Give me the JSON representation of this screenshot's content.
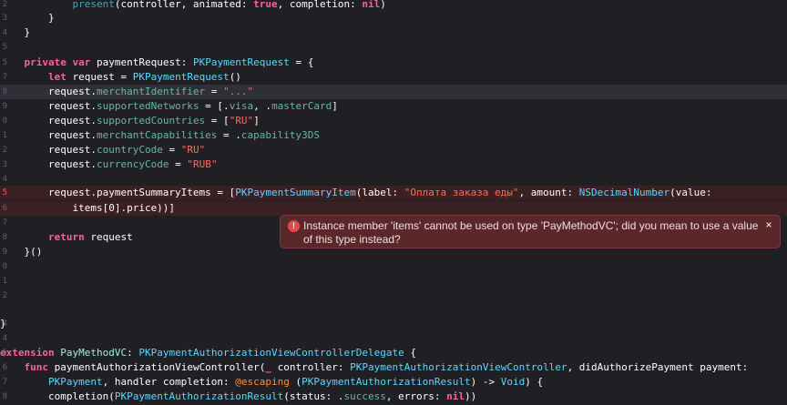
{
  "editor": {
    "lines": [
      {
        "num": "2",
        "segments": [
          [
            "pl",
            "            "
          ],
          [
            "fn",
            "present"
          ],
          [
            "pl",
            "(controller, animated: "
          ],
          [
            "kw",
            "true"
          ],
          [
            "pl",
            ", completion: "
          ],
          [
            "kw",
            "nil"
          ],
          [
            "pl",
            ")"
          ]
        ]
      },
      {
        "num": "3",
        "segments": [
          [
            "pl",
            "        }"
          ]
        ]
      },
      {
        "num": "4",
        "segments": [
          [
            "pl",
            "    }"
          ]
        ]
      },
      {
        "num": "5",
        "segments": []
      },
      {
        "num": "5",
        "segments": [
          [
            "pl",
            "    "
          ],
          [
            "kw",
            "private"
          ],
          [
            "pl",
            " "
          ],
          [
            "kw",
            "var"
          ],
          [
            "pl",
            " paymentRequest: "
          ],
          [
            "ty",
            "PKPaymentRequest"
          ],
          [
            "pl",
            " = {"
          ]
        ]
      },
      {
        "num": "7",
        "segments": [
          [
            "pl",
            "        "
          ],
          [
            "kw",
            "let"
          ],
          [
            "pl",
            " request = "
          ],
          [
            "ty",
            "PKPaymentRequest"
          ],
          [
            "pl",
            "()"
          ]
        ]
      },
      {
        "num": "8",
        "segments": [
          [
            "pl",
            "        request."
          ],
          [
            "prop",
            "merchantIdentifier"
          ],
          [
            "pl",
            " = "
          ],
          [
            "str",
            "\"...\""
          ]
        ]
      },
      {
        "num": "9",
        "segments": [
          [
            "pl",
            "        request."
          ],
          [
            "prop",
            "supportedNetworks"
          ],
          [
            "pl",
            " = [."
          ],
          [
            "prop",
            "visa"
          ],
          [
            "pl",
            ", ."
          ],
          [
            "prop",
            "masterCard"
          ],
          [
            "pl",
            "]"
          ]
        ]
      },
      {
        "num": "0",
        "segments": [
          [
            "pl",
            "        request."
          ],
          [
            "prop",
            "supportedCountries"
          ],
          [
            "pl",
            " = ["
          ],
          [
            "str",
            "\"RU\""
          ],
          [
            "pl",
            "]"
          ]
        ]
      },
      {
        "num": "1",
        "segments": [
          [
            "pl",
            "        request."
          ],
          [
            "prop",
            "merchantCapabilities"
          ],
          [
            "pl",
            " = ."
          ],
          [
            "prop",
            "capability3DS"
          ]
        ]
      },
      {
        "num": "2",
        "segments": [
          [
            "pl",
            "        request."
          ],
          [
            "prop",
            "countryCode"
          ],
          [
            "pl",
            " = "
          ],
          [
            "str",
            "\"RU\""
          ]
        ]
      },
      {
        "num": "3",
        "segments": [
          [
            "pl",
            "        request."
          ],
          [
            "prop",
            "currencyCode"
          ],
          [
            "pl",
            " = "
          ],
          [
            "str",
            "\"RUB\""
          ]
        ]
      },
      {
        "num": "4",
        "segments": []
      },
      {
        "num": "5",
        "segments": [
          [
            "pl",
            "        request.paymentSummaryItems = ["
          ],
          [
            "ty",
            "PKPaymentSummaryItem"
          ],
          [
            "pl",
            "(label: "
          ],
          [
            "str",
            "\"Оплата заказа еды\""
          ],
          [
            "pl",
            ", amount: "
          ],
          [
            "ty",
            "NSDecimalNumber"
          ],
          [
            "pl",
            "(value:"
          ]
        ]
      },
      {
        "num": "6",
        "segments": [
          [
            "pl",
            "            items[0].price))]"
          ]
        ]
      },
      {
        "num": "7",
        "segments": []
      },
      {
        "num": "8",
        "segments": [
          [
            "pl",
            "        "
          ],
          [
            "kw",
            "return"
          ],
          [
            "pl",
            " request"
          ]
        ]
      },
      {
        "num": "9",
        "segments": [
          [
            "pl",
            "    }()"
          ]
        ]
      },
      {
        "num": "0",
        "segments": []
      },
      {
        "num": "1",
        "segments": []
      },
      {
        "num": "2",
        "segments": []
      },
      {
        "num": "3",
        "segments": [
          [
            "pl",
            "}"
          ]
        ]
      },
      {
        "num": "4",
        "segments": []
      },
      {
        "num": "5",
        "segments": [
          [
            "kw",
            "extension"
          ],
          [
            "pl",
            " "
          ],
          [
            "cls",
            "PayMethodVC"
          ],
          [
            "pl",
            ": "
          ],
          [
            "ty",
            "PKPaymentAuthorizationViewControllerDelegate"
          ],
          [
            "pl",
            " {"
          ]
        ]
      },
      {
        "num": "6",
        "segments": [
          [
            "pl",
            "    "
          ],
          [
            "kw",
            "func"
          ],
          [
            "pl",
            " paymentAuthorizationViewController("
          ],
          [
            "kw",
            "_"
          ],
          [
            "pl",
            " controller: "
          ],
          [
            "ty",
            "PKPaymentAuthorizationViewController"
          ],
          [
            "pl",
            ", didAuthorizePayment payment:"
          ]
        ]
      },
      {
        "num": "7",
        "segments": [
          [
            "pl",
            "        "
          ],
          [
            "ty",
            "PKPayment"
          ],
          [
            "pl",
            ", handler completion: "
          ],
          [
            "at",
            "@escaping"
          ],
          [
            "pl",
            " ("
          ],
          [
            "ty",
            "PKPaymentAuthorizationResult"
          ],
          [
            "pl",
            ") -> "
          ],
          [
            "ty",
            "Void"
          ],
          [
            "pl",
            ") {"
          ]
        ]
      },
      {
        "num": "8",
        "segments": [
          [
            "pl",
            "        completion("
          ],
          [
            "ty",
            "PKPaymentAuthorizationResult"
          ],
          [
            "pl",
            "(status: ."
          ],
          [
            "prop",
            "success"
          ],
          [
            "pl",
            ", errors: "
          ],
          [
            "kw",
            "nil"
          ],
          [
            "pl",
            "))"
          ]
        ]
      }
    ]
  },
  "error": {
    "icon": "error-icon",
    "message": "Instance member 'items' cannot be used on type 'PayMethodVC'; did you mean to use a value of this type instead?",
    "close_label": "×"
  },
  "colors": {
    "background": "#1f1f24",
    "keyword": "#fc5fa3",
    "type": "#5dd8ff",
    "string": "#fc6a5d",
    "property": "#67b7a4",
    "error_bg": "#5a272b"
  }
}
